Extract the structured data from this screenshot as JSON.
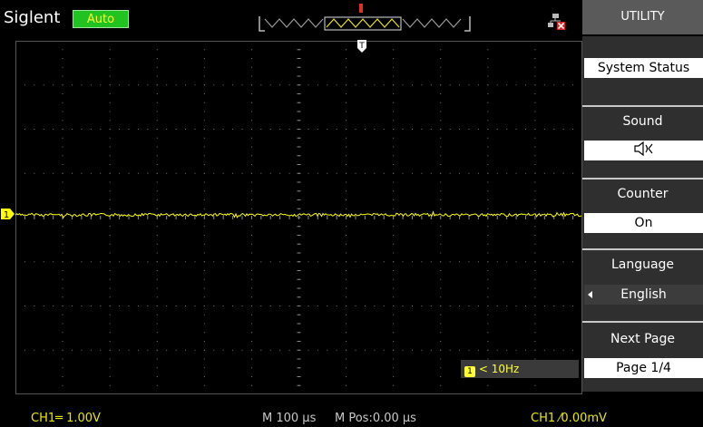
{
  "header": {
    "brand": "Siglent",
    "mode": "Auto"
  },
  "menu": {
    "title": "UTILITY",
    "items": [
      {
        "label": "",
        "value": "System Status"
      },
      {
        "label": "Sound",
        "value": "🕪"
      },
      {
        "label": "Counter",
        "value": "On"
      },
      {
        "label": "Language",
        "value": "English"
      },
      {
        "label": "Next Page",
        "value": "Page 1/4"
      }
    ]
  },
  "waveform": {
    "trigger_marker": "T",
    "channel_marker": "1",
    "frequency_readout": "< 10Hz"
  },
  "status": {
    "ch1_scale": "CH1═ 1.00V",
    "timebase": "M 100 µs",
    "mpos": "M Pos:0.00 µs",
    "trigger": "CH1 ⁄0.00mV"
  },
  "colors": {
    "trace": "#ffff00",
    "menu_title_bg": "#5a5a5a",
    "auto_badge": "#21c321",
    "ch1": "#e8e800"
  }
}
